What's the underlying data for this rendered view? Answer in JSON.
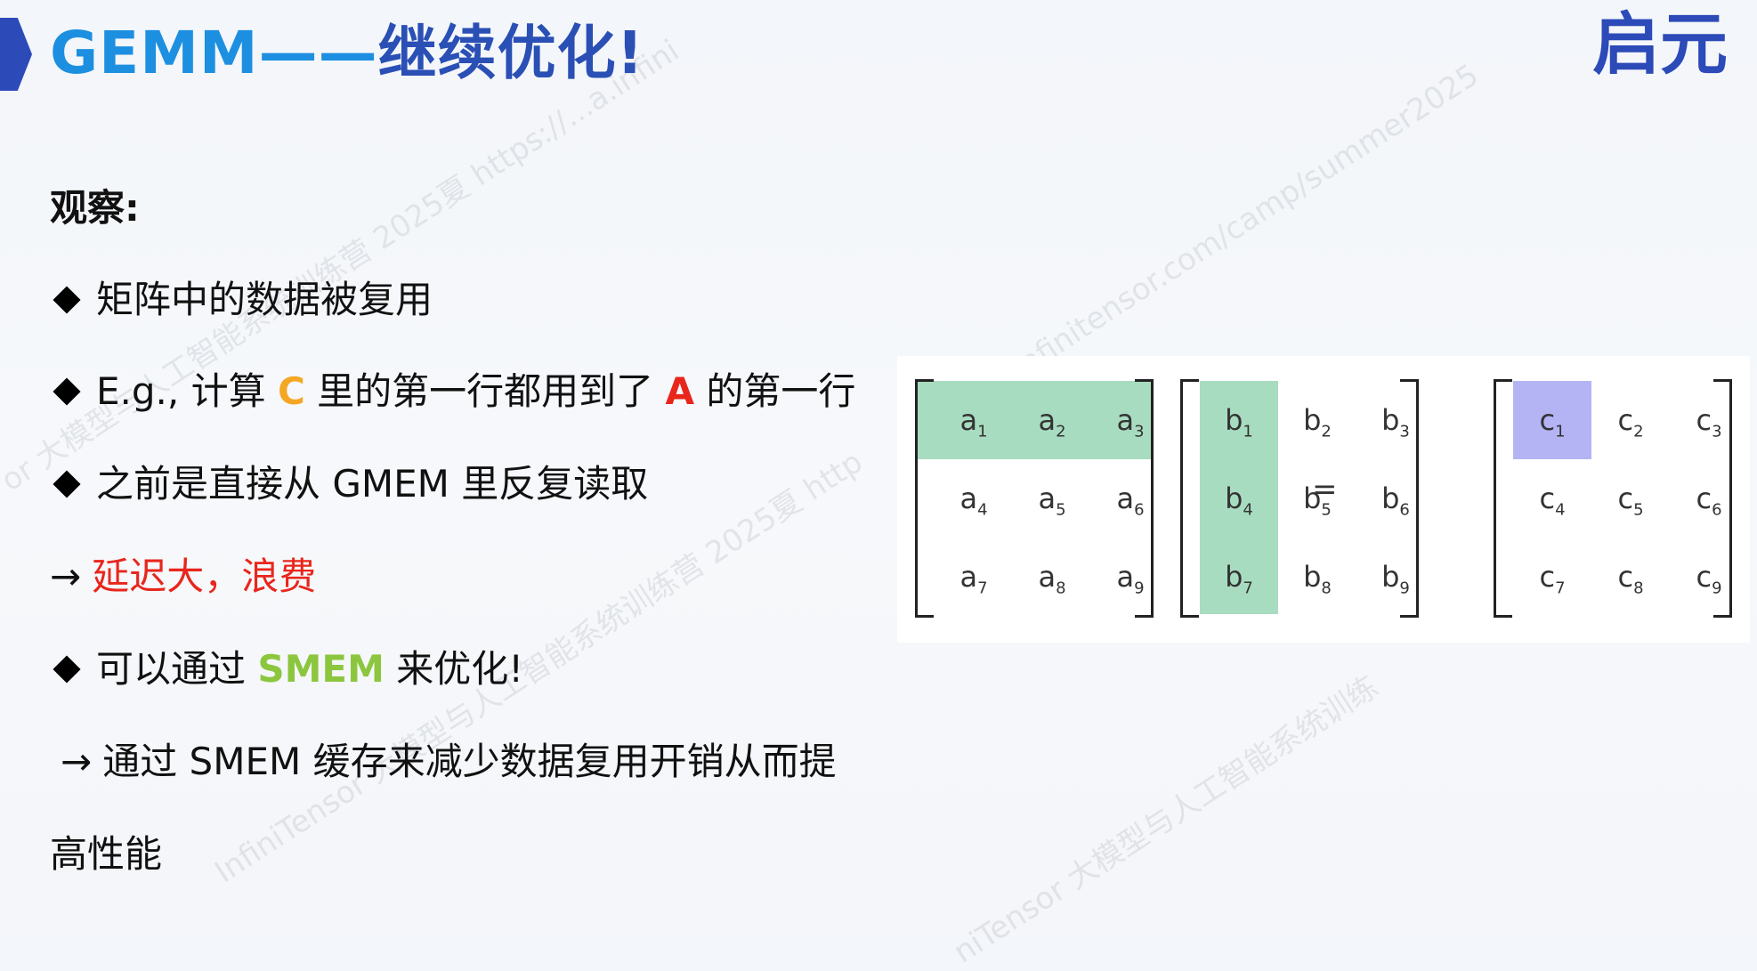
{
  "header": {
    "title_prefix": "GEMM——",
    "title_suffix": "继续优化!",
    "logo_text": "启元"
  },
  "watermarks": [
    "or 大模型与人工智能系统训练营 2025夏 https://...a.infini",
    "infinitensor.com/camp/summer2025",
    "InfiniTensor 大模型与人工智能系统训练营 2025夏 http",
    "niTensor 大模型与人工智能系统训练"
  ],
  "content": {
    "observe_label": "观察:",
    "items": [
      {
        "type": "bullet",
        "segments": [
          {
            "text": "矩阵中的数据被复用",
            "style": ""
          }
        ]
      },
      {
        "type": "bullet",
        "segments": [
          {
            "text": "E.g., 计算 ",
            "style": ""
          },
          {
            "text": "C",
            "style": "orange"
          },
          {
            "text": " 里的第一行都用到了 ",
            "style": ""
          },
          {
            "text": "A",
            "style": "red"
          },
          {
            "text": " 的第一行",
            "style": ""
          }
        ]
      },
      {
        "type": "bullet",
        "segments": [
          {
            "text": "之前是直接从 GMEM 里反复读取",
            "style": ""
          }
        ]
      },
      {
        "type": "arrow",
        "segments": [
          {
            "text": "延迟大，浪费",
            "style": "red-text"
          }
        ]
      },
      {
        "type": "bullet",
        "segments": [
          {
            "text": "可以通过 ",
            "style": ""
          },
          {
            "text": "SMEM",
            "style": "green"
          },
          {
            "text": " 来优化!",
            "style": ""
          }
        ]
      },
      {
        "type": "arrow-indent",
        "segments": [
          {
            "text": "通过 SMEM 缓存来减少数据复用开销从而提",
            "style": ""
          }
        ]
      },
      {
        "type": "plain",
        "segments": [
          {
            "text": "高性能",
            "style": ""
          }
        ]
      }
    ]
  },
  "diagram": {
    "equals": "=",
    "colors": {
      "row_highlight": "#a8dcc0",
      "col_highlight": "#a8dcc0",
      "cell_highlight": "#b4b4f5"
    },
    "matrices": [
      {
        "name": "a",
        "highlight": "row",
        "highlight_index": 0,
        "cells": [
          {
            "base": "a",
            "sub": "1"
          },
          {
            "base": "a",
            "sub": "2"
          },
          {
            "base": "a",
            "sub": "3"
          },
          {
            "base": "a",
            "sub": "4"
          },
          {
            "base": "a",
            "sub": "5"
          },
          {
            "base": "a",
            "sub": "6"
          },
          {
            "base": "a",
            "sub": "7"
          },
          {
            "base": "a",
            "sub": "8"
          },
          {
            "base": "a",
            "sub": "9"
          }
        ]
      },
      {
        "name": "b",
        "highlight": "col",
        "highlight_index": 0,
        "cells": [
          {
            "base": "b",
            "sub": "1"
          },
          {
            "base": "b",
            "sub": "2"
          },
          {
            "base": "b",
            "sub": "3"
          },
          {
            "base": "b",
            "sub": "4"
          },
          {
            "base": "b",
            "sub": "5"
          },
          {
            "base": "b",
            "sub": "6"
          },
          {
            "base": "b",
            "sub": "7"
          },
          {
            "base": "b",
            "sub": "8"
          },
          {
            "base": "b",
            "sub": "9"
          }
        ]
      },
      {
        "name": "c",
        "highlight": "cell",
        "highlight_index": 0,
        "cells": [
          {
            "base": "c",
            "sub": "1"
          },
          {
            "base": "c",
            "sub": "2"
          },
          {
            "base": "c",
            "sub": "3"
          },
          {
            "base": "c",
            "sub": "4"
          },
          {
            "base": "c",
            "sub": "5"
          },
          {
            "base": "c",
            "sub": "6"
          },
          {
            "base": "c",
            "sub": "7"
          },
          {
            "base": "c",
            "sub": "8"
          },
          {
            "base": "c",
            "sub": "9"
          }
        ]
      }
    ]
  }
}
